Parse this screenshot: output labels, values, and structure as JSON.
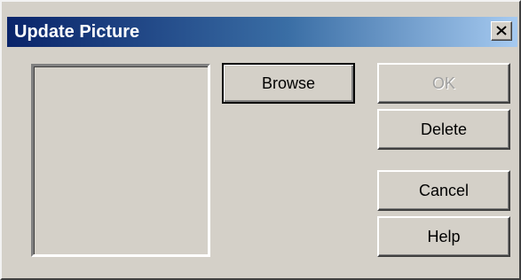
{
  "window": {
    "title": "Update Picture",
    "close_icon": "close-icon"
  },
  "buttons": {
    "browse": "Browse",
    "ok": "OK",
    "delete": "Delete",
    "cancel": "Cancel",
    "help": "Help"
  },
  "state": {
    "ok_enabled": false,
    "default_button": "Browse"
  },
  "colors": {
    "titlebar_start": "#0a246a",
    "titlebar_end": "#a6caf0",
    "face": "#d4d0c8"
  }
}
